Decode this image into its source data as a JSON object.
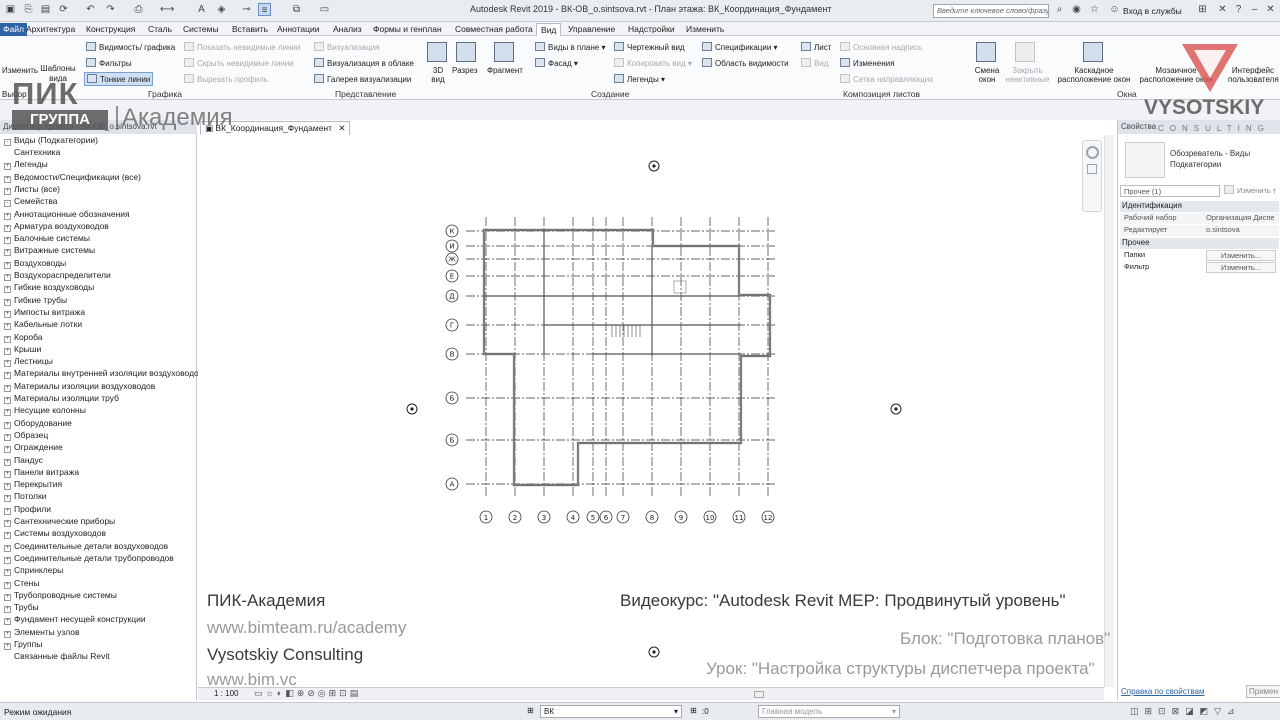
{
  "title_bar": {
    "title": "Autodesk Revit 2019 - ВК-ОВ_o.sintsova.rvt - План этажа: ВК_Координация_Фундамент",
    "search_placeholder": "Введите ключевое слово/фразу",
    "login": "Вход в службы"
  },
  "ribbon_tabs": [
    "Файл",
    "Архитектура",
    "Конструкция",
    "Сталь",
    "Системы",
    "Вставить",
    "Аннотации",
    "Анализ",
    "Формы и генплан",
    "Совместная работа",
    "Вид",
    "Управление",
    "Надстройки",
    "Изменить"
  ],
  "active_tab": "Вид",
  "ribbon": {
    "graphics": {
      "label": "Графика",
      "items": [
        "Видимость/ графика",
        "Фильтры",
        "Тонкие линии",
        "Показать невидимые линии",
        "Скрыть невидимые линии",
        "Вырезать профиль",
        "Шаблоны вида",
        "Изменить",
        "Выбор"
      ]
    },
    "presentation": {
      "label": "Представление",
      "items": [
        "Визуализация",
        "Визуализация в облаке",
        "Галерея визуализации"
      ]
    },
    "create": {
      "label": "Создание",
      "items": [
        "3D вид",
        "Разрез",
        "Фрагмент",
        "Виды в плане",
        "Фасад",
        "Чертежный вид",
        "Копировать вид",
        "Легенды",
        "Спецификации",
        "Область видимости"
      ]
    },
    "sheets": {
      "label": "Композиция листов",
      "items": [
        "Лист",
        "Вид",
        "Основная надпись",
        "Изменения",
        "Сетка направляющих"
      ]
    },
    "windows": {
      "label": "Окна",
      "items": [
        "Смена окон",
        "Закрыть неактивные",
        "Каскадное расположение окон",
        "Мозаичное расположение окон",
        "Интерфейс пользователя"
      ]
    }
  },
  "project_browser": {
    "header": "Диспетчер проекта - ВК-ОВ_o.sintsova.rvt",
    "root": "Виды (Подкатегории)",
    "items": [
      {
        "label": "Сантехника",
        "level": 1,
        "exp": ""
      },
      {
        "label": "Легенды",
        "level": 0,
        "exp": "+"
      },
      {
        "label": "Ведомости/Спецификации (все)",
        "level": 0,
        "exp": "+"
      },
      {
        "label": "Листы (все)",
        "level": 0,
        "exp": "+"
      },
      {
        "label": "Семейства",
        "level": 0,
        "exp": "-"
      },
      {
        "label": "Аннотационные обозначения",
        "level": 1,
        "exp": "+"
      },
      {
        "label": "Арматура воздуховодов",
        "level": 1,
        "exp": "+"
      },
      {
        "label": "Балочные системы",
        "level": 1,
        "exp": "+"
      },
      {
        "label": "Витражные системы",
        "level": 1,
        "exp": "+"
      },
      {
        "label": "Воздуховоды",
        "level": 1,
        "exp": "+"
      },
      {
        "label": "Воздухораспределители",
        "level": 1,
        "exp": "+"
      },
      {
        "label": "Гибкие воздуховоды",
        "level": 1,
        "exp": "+"
      },
      {
        "label": "Гибкие трубы",
        "level": 1,
        "exp": "+"
      },
      {
        "label": "Импосты витража",
        "level": 1,
        "exp": "+"
      },
      {
        "label": "Кабельные лотки",
        "level": 1,
        "exp": "+"
      },
      {
        "label": "Короба",
        "level": 1,
        "exp": "+"
      },
      {
        "label": "Крыши",
        "level": 1,
        "exp": "+"
      },
      {
        "label": "Лестницы",
        "level": 1,
        "exp": "+"
      },
      {
        "label": "Материалы внутренней изоляции воздуховодо",
        "level": 1,
        "exp": "+"
      },
      {
        "label": "Материалы изоляции воздуховодов",
        "level": 1,
        "exp": "+"
      },
      {
        "label": "Материалы изоляции труб",
        "level": 1,
        "exp": "+"
      },
      {
        "label": "Несущие колонны",
        "level": 1,
        "exp": "+"
      },
      {
        "label": "Оборудование",
        "level": 1,
        "exp": "+"
      },
      {
        "label": "Образец",
        "level": 1,
        "exp": "+"
      },
      {
        "label": "Ограждение",
        "level": 1,
        "exp": "+"
      },
      {
        "label": "Пандус",
        "level": 1,
        "exp": "+"
      },
      {
        "label": "Панели витража",
        "level": 1,
        "exp": "+"
      },
      {
        "label": "Перекрытия",
        "level": 1,
        "exp": "+"
      },
      {
        "label": "Потолки",
        "level": 1,
        "exp": "+"
      },
      {
        "label": "Профили",
        "level": 1,
        "exp": "+"
      },
      {
        "label": "Сантехнические приборы",
        "level": 1,
        "exp": "+"
      },
      {
        "label": "Системы воздуховодов",
        "level": 1,
        "exp": "+"
      },
      {
        "label": "Соединительные детали воздуховодов",
        "level": 1,
        "exp": "+"
      },
      {
        "label": "Соединительные детали трубопроводов",
        "level": 1,
        "exp": "+"
      },
      {
        "label": "Спринклеры",
        "level": 1,
        "exp": "+"
      },
      {
        "label": "Стены",
        "level": 1,
        "exp": "+"
      },
      {
        "label": "Трубопроводные системы",
        "level": 1,
        "exp": "+"
      },
      {
        "label": "Трубы",
        "level": 1,
        "exp": "+"
      },
      {
        "label": "Фундамент несущей конструкции",
        "level": 1,
        "exp": "+"
      },
      {
        "label": "Элементы узлов",
        "level": 1,
        "exp": "+"
      },
      {
        "label": "Группы",
        "level": 0,
        "exp": "+"
      },
      {
        "label": "Связанные файлы Revit",
        "level": 0,
        "exp": ""
      }
    ]
  },
  "view_tab": "ВК_Координация_Фундамент",
  "grid": {
    "rows": [
      "К",
      "И",
      "Ж",
      "Е",
      "Д",
      "Г",
      "В",
      "Б",
      "Б",
      "А"
    ],
    "cols": [
      "1",
      "2",
      "3",
      "4",
      "5",
      "6",
      "7",
      "8",
      "9",
      "10",
      "11",
      "12"
    ]
  },
  "properties": {
    "title": "Свойства",
    "type_name": "Обозреватель - Виды Подкатегории",
    "instance": "Прочее (1)",
    "edit_type": "Изменить т",
    "groups": [
      {
        "name": "Идентификация",
        "rows": [
          {
            "k": "Рабочий набор",
            "v": "Организация Диспе"
          },
          {
            "k": "Редактирует",
            "v": "o.sintsova"
          }
        ]
      },
      {
        "name": "Прочее",
        "rows": [
          {
            "k": "Папки",
            "v": "Изменить..."
          },
          {
            "k": "Фильтр",
            "v": "Изменить..."
          }
        ]
      }
    ],
    "help_link": "Справка по свойствам",
    "apply": "Примен"
  },
  "view_control": {
    "scale": "1 : 100"
  },
  "status": {
    "text": "Режим ожидания",
    "workset": "ВК",
    "coords": ":0",
    "model": "Главная модель"
  },
  "overlay": {
    "pik_academy": "ПИК-Академия",
    "url1": "www.bimteam.ru/academy",
    "vysotskiy": "Vysotskiy Consulting",
    "url2": "www.bim.vc",
    "course": "Видеокурс: \"Autodesk Revit MEP: Продвинутый уровень\"",
    "block": "Блок: \"Подготовка планов\"",
    "lesson": "Урок: \"Настройка структуры диспетчера проекта\""
  },
  "watermarks": {
    "pik_line1": "ПИК",
    "pik_line2": "ГРУППА",
    "pik_academy": "Академия",
    "vs_name": "VYSOTSKIY",
    "vs_sub": "CONSULTING"
  },
  "colors": {
    "accent": "#2f63a8",
    "watermark_red": "#d9534f"
  }
}
